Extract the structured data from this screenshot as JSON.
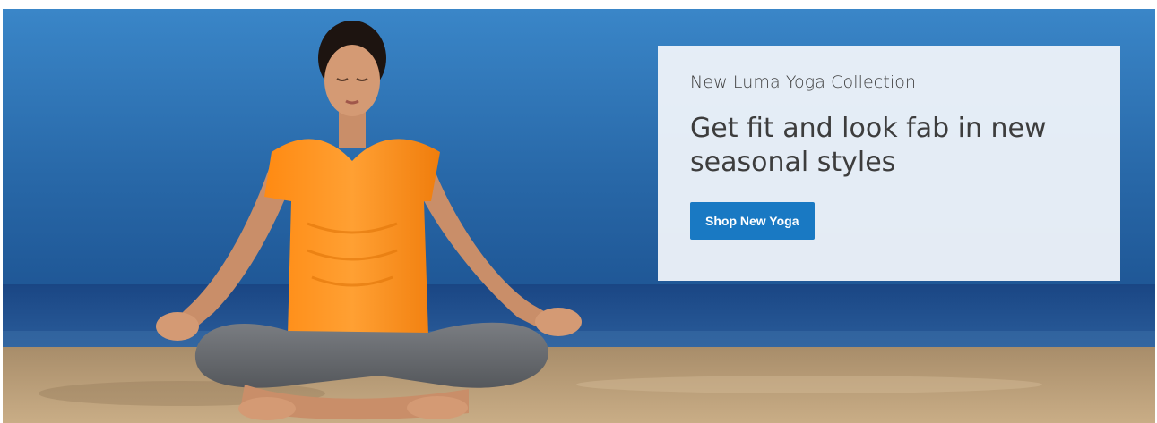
{
  "banner": {
    "kicker": "New Luma Yoga Collection",
    "headline": "Get fit and look fab in new seasonal styles",
    "cta_label": "Shop New Yoga"
  },
  "colors": {
    "sky": "#2b6fb0",
    "sea": "#1f4f8e",
    "sand": "#b89a73",
    "shirt": "#ff8f1f",
    "pants": "#6b6e72",
    "button": "#1979c3",
    "card": "#f0f4fa"
  }
}
